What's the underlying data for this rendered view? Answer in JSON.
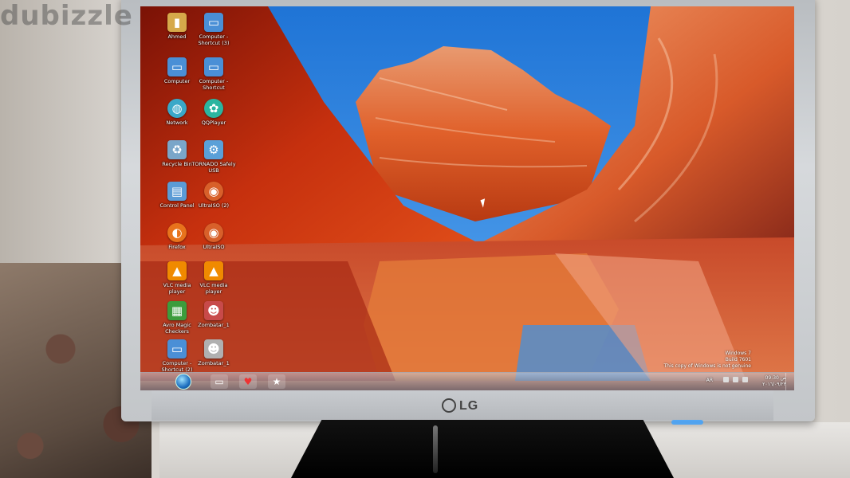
{
  "watermark": "dubizzle",
  "monitor": {
    "brand": "LG"
  },
  "desktop": {
    "icons": [
      {
        "label": "Ahmed",
        "icon": "user-folder-icon",
        "color": "#d6a94a"
      },
      {
        "label": "Computer - Shortcut (3)",
        "icon": "computer-icon",
        "color": "#4a8fd6"
      },
      {
        "label": "Computer",
        "icon": "computer-icon",
        "color": "#4a8fd6"
      },
      {
        "label": "Computer - Shortcut",
        "icon": "computer-icon",
        "color": "#4a8fd6"
      },
      {
        "label": "Network",
        "icon": "network-icon",
        "color": "#3aa8c8"
      },
      {
        "label": "QQPlayer",
        "icon": "qqplayer-icon",
        "color": "#2bb5a0"
      },
      {
        "label": "Recycle Bin",
        "icon": "recycle-bin-icon",
        "color": "#7aa6c9"
      },
      {
        "label": "TORNADO Safely USB",
        "icon": "usb-icon",
        "color": "#5aa0d8"
      },
      {
        "label": "Control Panel",
        "icon": "control-panel-icon",
        "color": "#5b9bd5"
      },
      {
        "label": "UltraISO (2)",
        "icon": "disc-icon",
        "color": "#d8602a"
      },
      {
        "label": "Firefox",
        "icon": "firefox-icon",
        "color": "#e8731c"
      },
      {
        "label": "UltraISO",
        "icon": "disc-icon",
        "color": "#d8602a"
      },
      {
        "label": "VLC media player",
        "icon": "vlc-cone-icon",
        "color": "#f08a00"
      },
      {
        "label": "VLC media player",
        "icon": "vlc-cone-icon",
        "color": "#f08a00"
      },
      {
        "label": "Avro Magic Checkers",
        "icon": "checkers-icon",
        "color": "#3c9c3c"
      },
      {
        "label": "Zombatar_1",
        "icon": "zombie-icon",
        "color": "#c84a4a"
      },
      {
        "label": "Computer - Shortcut (2)",
        "icon": "computer-icon",
        "color": "#4a8fd6"
      },
      {
        "label": "Zombatar_1",
        "icon": "zombie-icon",
        "color": "#b0b0b0"
      }
    ],
    "watermark_lines": [
      "Windows 7",
      "Build 7601",
      "This copy of Windows is not genuine"
    ]
  },
  "taskbar": {
    "pinned": [
      {
        "name": "explorer-icon",
        "glyph": "▭"
      },
      {
        "name": "app-icon",
        "glyph": "♥"
      },
      {
        "name": "star-app-icon",
        "glyph": "★"
      }
    ],
    "language": "AR",
    "time": "09:30 ص",
    "date": "٢٠١٦/٠٩/٢٣"
  }
}
